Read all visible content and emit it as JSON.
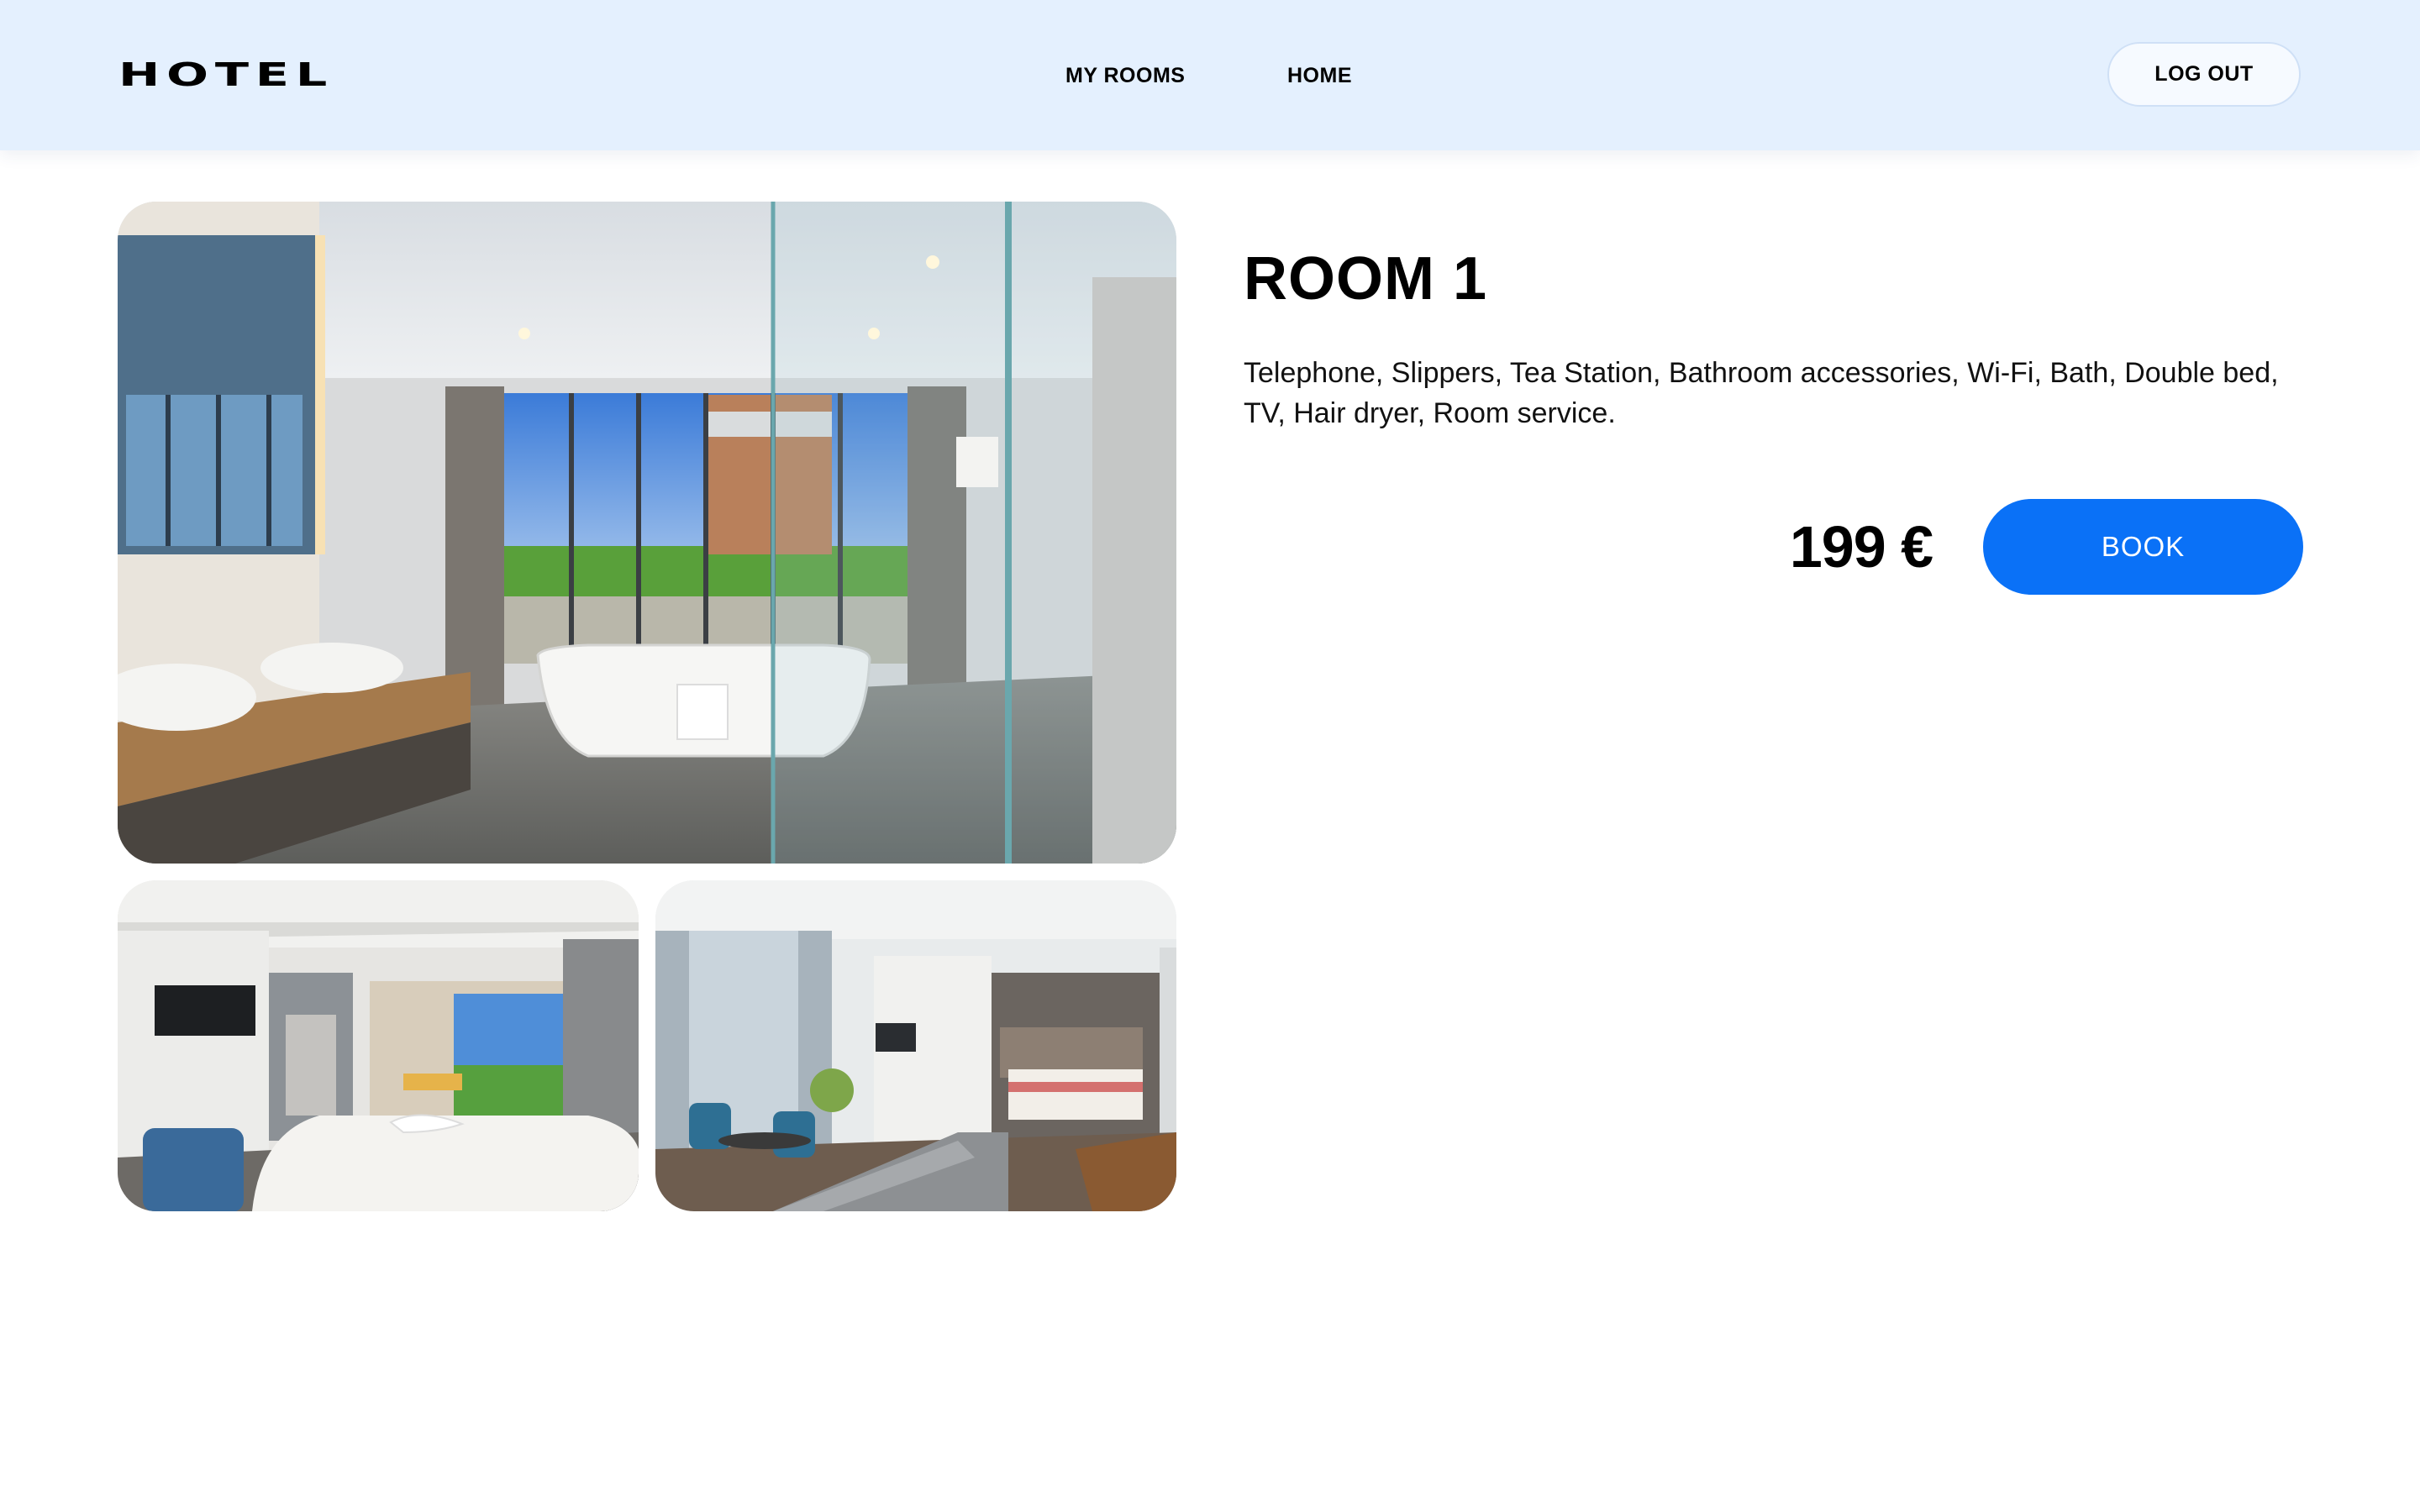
{
  "header": {
    "logo": "HOTEL",
    "nav": [
      {
        "label": "MY ROOMS"
      },
      {
        "label": "HOME"
      }
    ],
    "logout_label": "LOG OUT"
  },
  "room": {
    "title": "ROOM 1",
    "amenities": "Telephone, Slippers, Tea Station, Bathroom accessories, Wi-Fi, Bath, Double bed, TV, Hair dryer, Room service.",
    "price": "199 €",
    "book_label": "BOOK"
  },
  "colors": {
    "header_bg": "#e4f0fe",
    "accent": "#0a71f7",
    "text": "#000000"
  }
}
